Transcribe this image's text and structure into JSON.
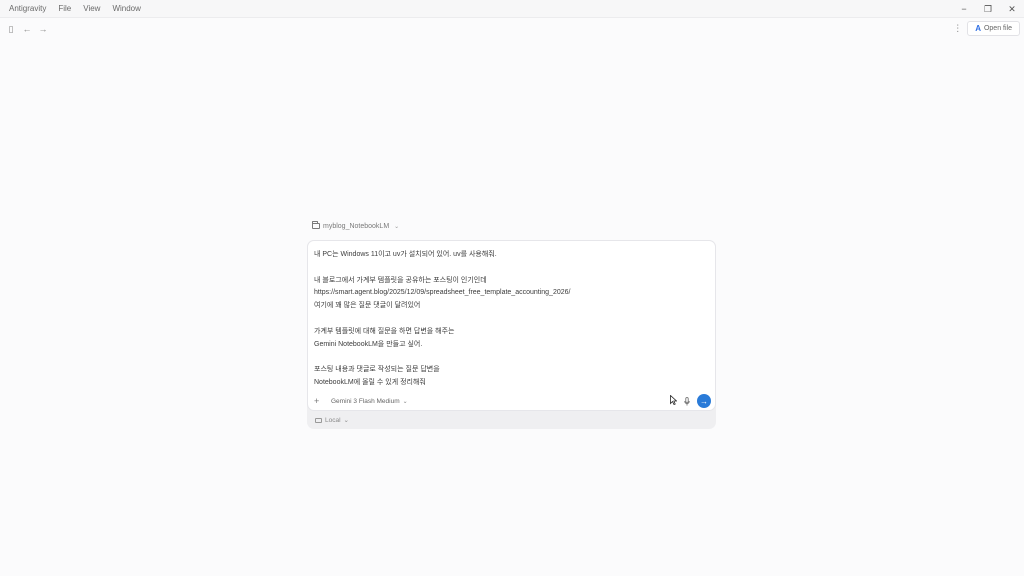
{
  "menubar": {
    "items": [
      "Antigravity",
      "File",
      "View",
      "Window"
    ],
    "controls": {
      "minimize": "−",
      "restore": "❐",
      "close": "✕"
    }
  },
  "toolbar": {
    "sidebar_icon": "▯",
    "back_icon": "←",
    "forward_icon": "→",
    "more_icon": "⋮",
    "open_label": "Open file",
    "open_logo": "A"
  },
  "workspace": {
    "name": "myblog_NotebookLM",
    "chevron": "⌄"
  },
  "composer": {
    "lines": [
      "내 PC는 Windows 11이고 uv가 설치되어 있어. uv를 사용해줘.",
      "",
      "내 블로그에서 가계부 템플릿을 공유하는 포스팅이 인기인데",
      "https://smart.agent.blog/2025/12/09/spreadsheet_free_template_accounting_2026/",
      "여기에 꽤 많은 질문 댓글이 달려있어",
      "",
      "가계부 템플릿에 대해 질문을 하면 답변을 해주는",
      "Gemini NotebookLM을 만들고 싶어.",
      "",
      "포스팅 내용과 댓글로 작성되는 질문 답변을",
      "NotebookLM에 올릴 수 있게 정리해줘"
    ],
    "plus_icon": "+",
    "model": "Gemini 3 Flash Medium",
    "model_chevron": "⌄",
    "send_icon": "→",
    "local_label": "Local",
    "local_chevron": "⌄"
  }
}
